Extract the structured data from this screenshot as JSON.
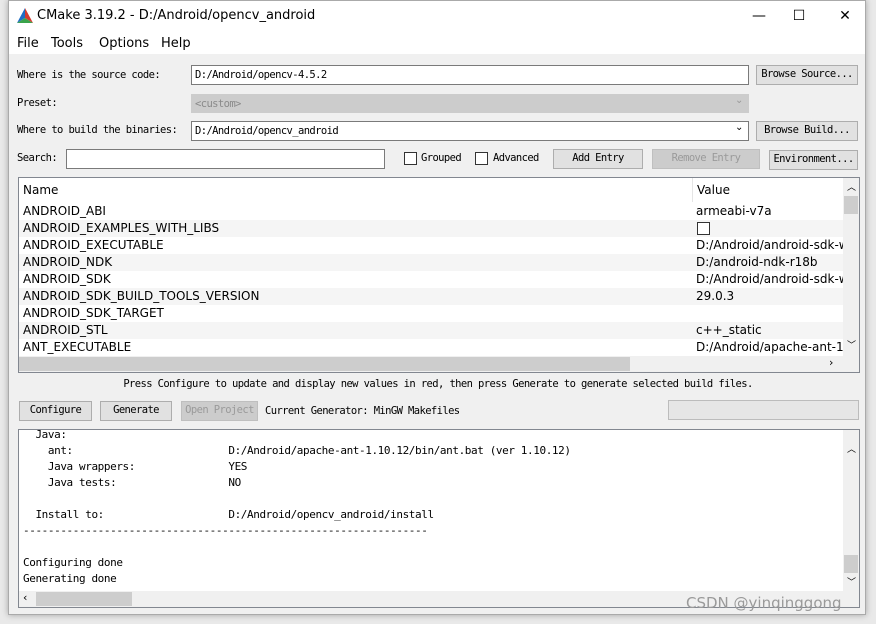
{
  "window": {
    "title": "CMake 3.19.2 - D:/Android/opencv_android",
    "minimize": "—",
    "maximize": "☐",
    "close": "✕"
  },
  "menu": [
    "File",
    "Tools",
    "Options",
    "Help"
  ],
  "source": {
    "label": "Where is the source code:",
    "value": "D:/Android/opencv-4.5.2",
    "button": "Browse Source..."
  },
  "preset": {
    "label": "Preset:",
    "value": "<custom>"
  },
  "build": {
    "label": "Where to build the binaries:",
    "value": "D:/Android/opencv_android",
    "button": "Browse Build..."
  },
  "search": {
    "label": "Search:",
    "value": "",
    "grouped": "Grouped",
    "advanced": "Advanced",
    "add_entry": "Add Entry",
    "remove_entry": "Remove Entry",
    "environment": "Environment..."
  },
  "table": {
    "headers": [
      "Name",
      "Value"
    ],
    "rows": [
      {
        "name": "ANDROID_ABI",
        "value": "armeabi-v7a"
      },
      {
        "name": "ANDROID_EXAMPLES_WITH_LIBS",
        "value": ""
      },
      {
        "name": "ANDROID_EXECUTABLE",
        "value": "D:/Android/android-sdk-w"
      },
      {
        "name": "ANDROID_NDK",
        "value": "D:/android-ndk-r18b"
      },
      {
        "name": "ANDROID_SDK",
        "value": "D:/Android/android-sdk-w"
      },
      {
        "name": "ANDROID_SDK_BUILD_TOOLS_VERSION",
        "value": "29.0.3"
      },
      {
        "name": "ANDROID_SDK_TARGET",
        "value": ""
      },
      {
        "name": "ANDROID_STL",
        "value": "c++_static"
      },
      {
        "name": "ANT_EXECUTABLE",
        "value": "D:/Android/apache-ant-1."
      }
    ]
  },
  "hint": "Press Configure to update and display new values in red, then press Generate to generate selected build files.",
  "actions": {
    "configure": "Configure",
    "generate": "Generate",
    "open_project": "Open Project",
    "generator": "Current Generator: MinGW Makefiles"
  },
  "output": [
    "  Java:",
    "    ant:                         D:/Android/apache-ant-1.10.12/bin/ant.bat (ver 1.10.12)",
    "    Java wrappers:               YES",
    "    Java tests:                  NO",
    "",
    "  Install to:                    D:/Android/opencv_android/install",
    "-----------------------------------------------------------------",
    "",
    "Configuring done",
    "Generating done"
  ],
  "watermark": "CSDN @yinqinggong"
}
